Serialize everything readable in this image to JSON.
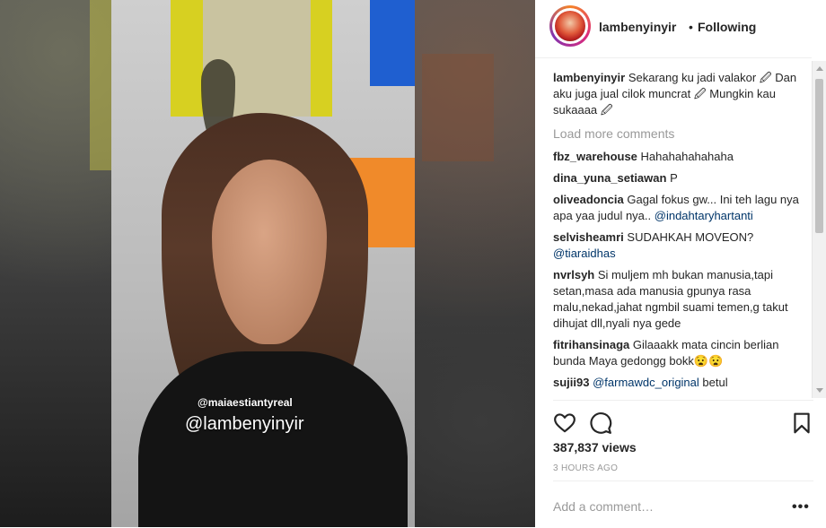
{
  "video": {
    "overlay_tag_small": "@maiaestiantyreal",
    "overlay_tag_big": "@lambenyinyir"
  },
  "header": {
    "username": "lambenyinyir",
    "separator": "•",
    "follow_status": "Following"
  },
  "caption": {
    "username": "lambenyinyir",
    "text": "Sekarang ku jadi valakor 🖉 Dan aku juga jual cilok muncrat 🖉 Mungkin kau sukaaaa 🖉"
  },
  "load_more_label": "Load more comments",
  "comments": [
    {
      "user": "fbz_warehouse",
      "text": "Hahahahahahaha",
      "mention": ""
    },
    {
      "user": "dina_yuna_setiawan",
      "text": "P",
      "mention": ""
    },
    {
      "user": "oliveadoncia",
      "text": "Gagal fokus gw... Ini teh lagu nya apa yaa judul nya..",
      "mention": "@indahtaryhartanti"
    },
    {
      "user": "selvisheamri",
      "text": "SUDAHKAH MOVEON?",
      "mention": "@tiaraidhas"
    },
    {
      "user": "nvrlsyh",
      "text": "Si muljem mh bukan manusia,tapi setan,masa ada manusia gpunya rasa malu,nekad,jahat ngmbil suami temen,g takut dihujat dll,nyali nya gede",
      "mention": ""
    },
    {
      "user": "fitrihansinaga",
      "text": "Gilaaakk mata cincin berlian bunda Maya gedongg bokk😧😧",
      "mention": ""
    },
    {
      "user": "sujii93",
      "text": "betul",
      "mention": "@farmawdc_original"
    }
  ],
  "stats": {
    "views": "387,837 views",
    "time": "3 HOURS AGO"
  },
  "add_comment": {
    "placeholder": "Add a comment…",
    "more": "•••"
  },
  "icons": {
    "like": "heart-icon",
    "comment": "comment-bubble-icon",
    "save": "bookmark-icon",
    "more": "more-options-icon"
  }
}
